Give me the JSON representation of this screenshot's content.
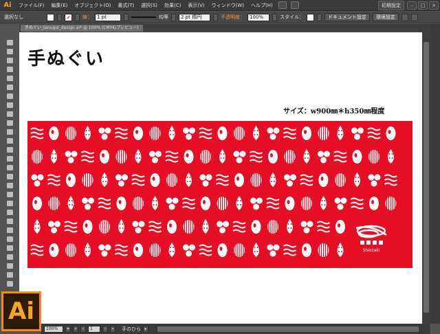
{
  "menu": {
    "app_logo": "Ai",
    "items": [
      "ファイル(F)",
      "編集(E)",
      "オブジェクト(O)",
      "書式(T)",
      "選択(S)",
      "効果(C)",
      "表示(V)",
      "ウィンドウ(W)",
      "ヘルプ(H)"
    ],
    "workspace": "初期設定",
    "window_controls": [
      "–",
      "□",
      "×"
    ]
  },
  "control_bar": {
    "selection": "選択なし",
    "stroke_label": "線：",
    "stroke_weight": "1 pt",
    "stroke_profile": "均等",
    "brush": "2 pt 楕円",
    "opacity_label": "不透明度：",
    "opacity_value": "100%",
    "style_label": "スタイル：",
    "doc_settings": "ドキュメント設定",
    "preferences": "環境設定"
  },
  "document_tab": {
    "label": "手ぬぐい_tenugui_design.ai* @ 100% (CMYK/プレビュー)"
  },
  "artboard": {
    "title": "手ぬぐい",
    "size": "サイズ：w900㎜＊h350㎜程度",
    "brand_text": "Shiozaki"
  },
  "status_bar": {
    "zoom": "100%",
    "page": "1",
    "tool_text": "手のひら"
  },
  "badge": {
    "text": "Ai"
  },
  "colors": {
    "towel_red": "#e60e25",
    "accent_orange": "#f08b1d",
    "ui_dark": "#535353"
  },
  "icons": {
    "tools": [
      "selection-tool-icon",
      "direct-selection-tool-icon",
      "magic-wand-icon",
      "lasso-icon",
      "pen-tool-icon",
      "type-tool-icon",
      "line-tool-icon",
      "rectangle-tool-icon",
      "paintbrush-icon",
      "pencil-icon",
      "blob-brush-icon",
      "eraser-icon",
      "rotate-icon",
      "scale-icon",
      "width-tool-icon",
      "free-transform-icon",
      "shape-builder-icon",
      "perspective-grid-icon",
      "mesh-icon",
      "gradient-icon",
      "eyedropper-icon",
      "blend-icon",
      "symbol-sprayer-icon",
      "column-graph-icon",
      "artboard-tool-icon",
      "slice-icon",
      "hand-tool-icon",
      "zoom-tool-icon"
    ]
  }
}
